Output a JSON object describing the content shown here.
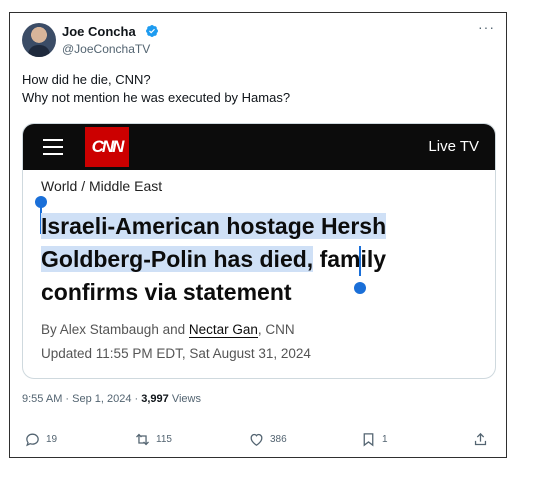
{
  "tweet": {
    "author_name": "Joe Concha",
    "handle": "@JoeConchaTV",
    "text_lines": [
      "How did he die, CNN?",
      "Why not mention he was executed by Hamas?"
    ],
    "timestamp": "9:55 AM · Sep 1, 2024 · ",
    "views_count": "3,997",
    "views_label": " Views",
    "more_label": "···"
  },
  "embedded_article": {
    "logo_text": "CNN",
    "live_tv_label": "Live TV",
    "section": "World / Middle East",
    "headline_highlighted_1": "Israeli-American hostage Hersh",
    "headline_highlighted_2": "Goldberg-Polin has died,",
    "headline_rest": " family",
    "headline_line3": "confirms via statement",
    "byline_prefix": "By Alex Stambaugh and ",
    "byline_author2": "Nectar Gan",
    "byline_suffix": ", CNN",
    "updated": "Updated 11:55 PM EDT, Sat August 31, 2024"
  },
  "actions": {
    "replies": "19",
    "reposts": "115",
    "likes": "386",
    "bookmarks": "1"
  },
  "colors": {
    "verified_blue": "#1d9bf0",
    "cnn_red": "#cc0000",
    "selection_blue": "#1a6fd8",
    "highlight": "#cfe0f6"
  }
}
